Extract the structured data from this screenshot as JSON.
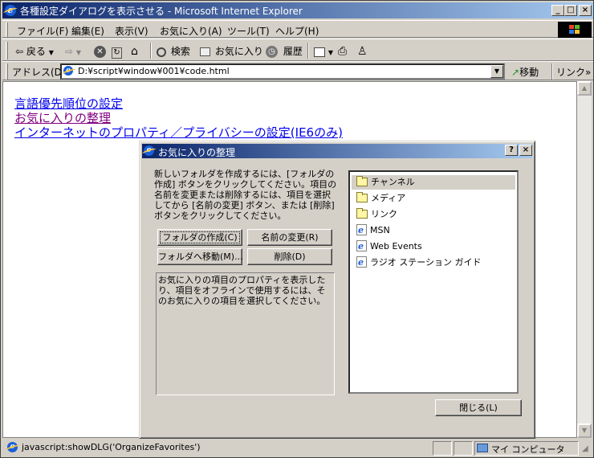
{
  "window": {
    "title": "各種設定ダイアログを表示させる - Microsoft Internet Explorer",
    "minimize": "_",
    "maximize": "□",
    "close": "×"
  },
  "menu": [
    "ファイル(F)",
    "編集(E)",
    "表示(V)",
    "お気に入り(A)",
    "ツール(T)",
    "ヘルプ(H)"
  ],
  "toolbar": {
    "back": "戻る",
    "search": "検索",
    "favorites": "お気に入り",
    "history": "履歴"
  },
  "address": {
    "label": "アドレス(D)",
    "value": "D:¥script¥window¥001¥code.html",
    "go": "移動",
    "links": "リンク"
  },
  "content": {
    "links": [
      "言語優先順位の設定",
      "お気に入りの整理",
      "インターネットのプロパティ／プライバシーの設定(IE6のみ)"
    ]
  },
  "dialog": {
    "title": "お気に入りの整理",
    "help": "?",
    "close": "×",
    "description": "新しいフォルダを作成するには、[フォルダの作成] ボタンをクリックしてください。項目の名前を変更または削除するには、項目を選択してから [名前の変更] ボタン、または [削除] ボタンをクリックしてください。",
    "buttons": {
      "create_folder": "フォルダの作成(C)",
      "rename": "名前の変更(R)",
      "move": "フォルダへ移動(M)...",
      "delete": "削除(D)",
      "close": "閉じる(L)"
    },
    "info": "お気に入りの項目のプロパティを表示したり、項目をオフラインで使用するには、そのお気に入りの項目を選択してください。",
    "items": [
      {
        "label": "チャンネル",
        "icon": "folder-icon"
      },
      {
        "label": "メディア",
        "icon": "folder-icon"
      },
      {
        "label": "リンク",
        "icon": "folder-icon"
      },
      {
        "label": "MSN",
        "icon": "url-icon"
      },
      {
        "label": "Web Events",
        "icon": "url-icon"
      },
      {
        "label": "ラジオ ステーション ガイド",
        "icon": "url-icon"
      }
    ]
  },
  "status": {
    "text": "javascript:showDLG('OrganizeFavorites')",
    "zone": "マイ コンピュータ"
  },
  "colors": {
    "titlebar": "#0a246a",
    "link": "#0000ee",
    "visited_link": "#800080"
  }
}
